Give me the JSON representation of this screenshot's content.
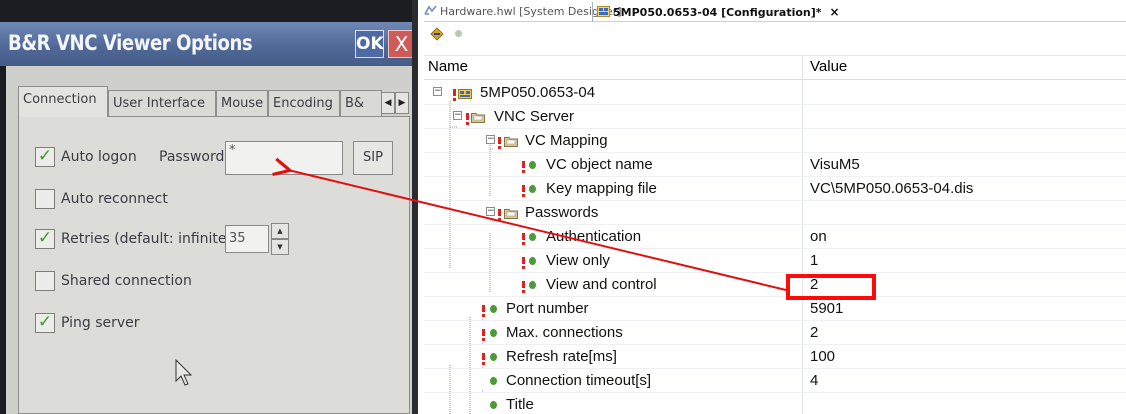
{
  "vnc_dialog": {
    "title": "B&R VNC Viewer Options",
    "ok_label": "OK",
    "close_label": "X",
    "tabs": [
      {
        "label": "Connection",
        "active": true
      },
      {
        "label": "User Interface",
        "active": false
      },
      {
        "label": "Mouse",
        "active": false
      },
      {
        "label": "Encoding",
        "active": false
      },
      {
        "label": "B&",
        "active": false
      }
    ],
    "options": [
      {
        "label": "Auto logon",
        "checked": true
      },
      {
        "label": "Auto reconnect",
        "checked": false
      },
      {
        "label": "Retries (default: infinite):",
        "checked": true
      },
      {
        "label": "Shared connection",
        "checked": false
      },
      {
        "label": "Ping server",
        "checked": true
      }
    ],
    "password_label": "Password:",
    "password_value": "*",
    "sip_label": "SIP",
    "retries_value": "35"
  },
  "designer": {
    "tabs": [
      {
        "label": "Hardware.hwl [System Designer]",
        "active": false
      },
      {
        "label": "5MP050.0653-04 [Configuration]*",
        "active": true
      }
    ],
    "close_glyph": "×",
    "columns": {
      "name": "Name",
      "value": "Value"
    },
    "rows": [
      {
        "name": "5MP050.0653-04",
        "value": "",
        "icon": "device-icon"
      },
      {
        "name": "VNC Server",
        "value": "",
        "icon": "folder-icon"
      },
      {
        "name": "VC Mapping",
        "value": "",
        "icon": "folder-icon"
      },
      {
        "name": "VC object name",
        "value": "VisuM5",
        "icon": "parameter-icon"
      },
      {
        "name": "Key mapping file",
        "value": "VC\\5MP050.0653-04.dis",
        "icon": "parameter-icon"
      },
      {
        "name": "Passwords",
        "value": "",
        "icon": "folder-icon"
      },
      {
        "name": "Authentication",
        "value": "on",
        "icon": "parameter-icon"
      },
      {
        "name": "View only",
        "value": "1",
        "icon": "parameter-icon"
      },
      {
        "name": "View and control",
        "value": "2",
        "icon": "parameter-icon",
        "highlighted": true
      },
      {
        "name": "Port number",
        "value": "5901",
        "icon": "parameter-icon"
      },
      {
        "name": "Max. connections",
        "value": "2",
        "icon": "parameter-icon"
      },
      {
        "name": "Refresh rate[ms]",
        "value": "100",
        "icon": "parameter-icon"
      },
      {
        "name": "Connection timeout[s]",
        "value": "4",
        "icon": "parameter-icon"
      },
      {
        "name": "Title",
        "value": "",
        "icon": "parameter-icon"
      }
    ]
  },
  "annotation": {
    "highlight_color": "#ff0a0a",
    "arrow_color": "#e01010"
  }
}
